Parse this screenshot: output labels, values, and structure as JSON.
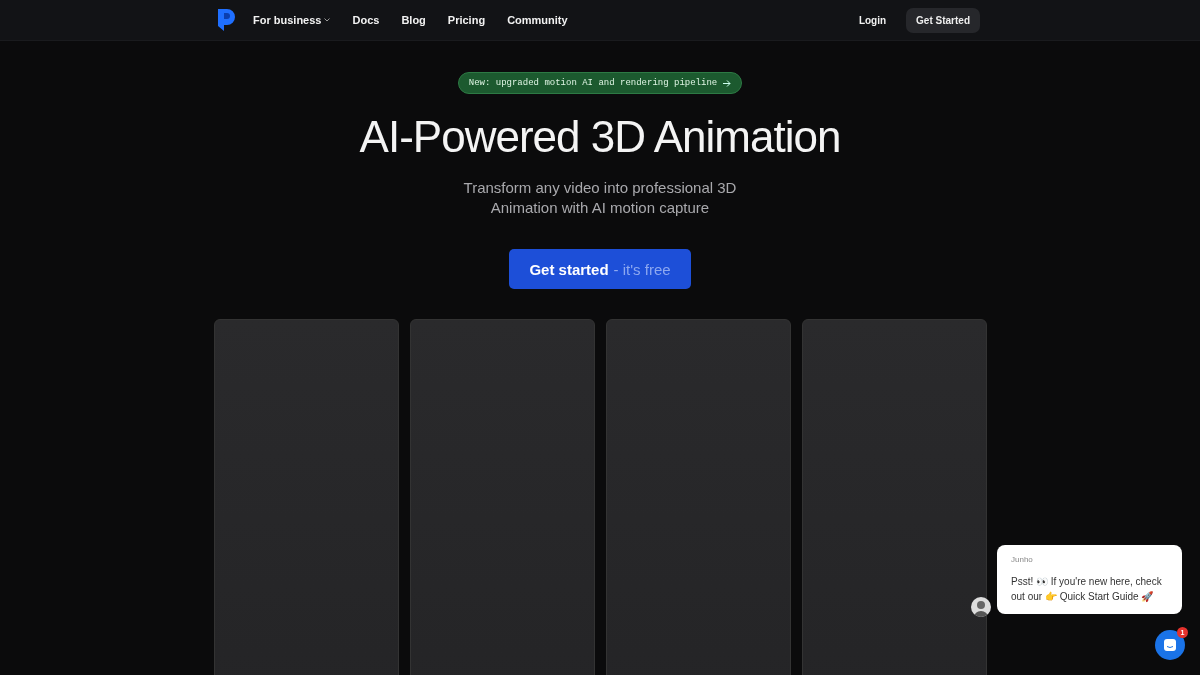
{
  "nav": {
    "items": [
      {
        "label": "For business",
        "dropdown": true
      },
      {
        "label": "Docs",
        "dropdown": false
      },
      {
        "label": "Blog",
        "dropdown": false
      },
      {
        "label": "Pricing",
        "dropdown": false
      },
      {
        "label": "Community",
        "dropdown": false
      }
    ],
    "login": "Login",
    "cta": "Get Started"
  },
  "announcement": "New: upgraded motion AI and rendering pipeline",
  "hero": {
    "title": "AI-Powered 3D Animation",
    "subtitle": "Transform any video into professional 3D Animation with AI motion capture",
    "cta": {
      "main": "Get started",
      "suffix": "- it's free"
    }
  },
  "cards": [
    {
      "kind": "placeholder"
    },
    {
      "kind": "placeholder"
    },
    {
      "kind": "placeholder"
    },
    {
      "kind": "placeholder"
    }
  ],
  "chat": {
    "sender": "Junho",
    "message": "Psst! 👀 If you're new here, check out our 👉 Quick Start Guide 🚀",
    "badge": "1"
  }
}
